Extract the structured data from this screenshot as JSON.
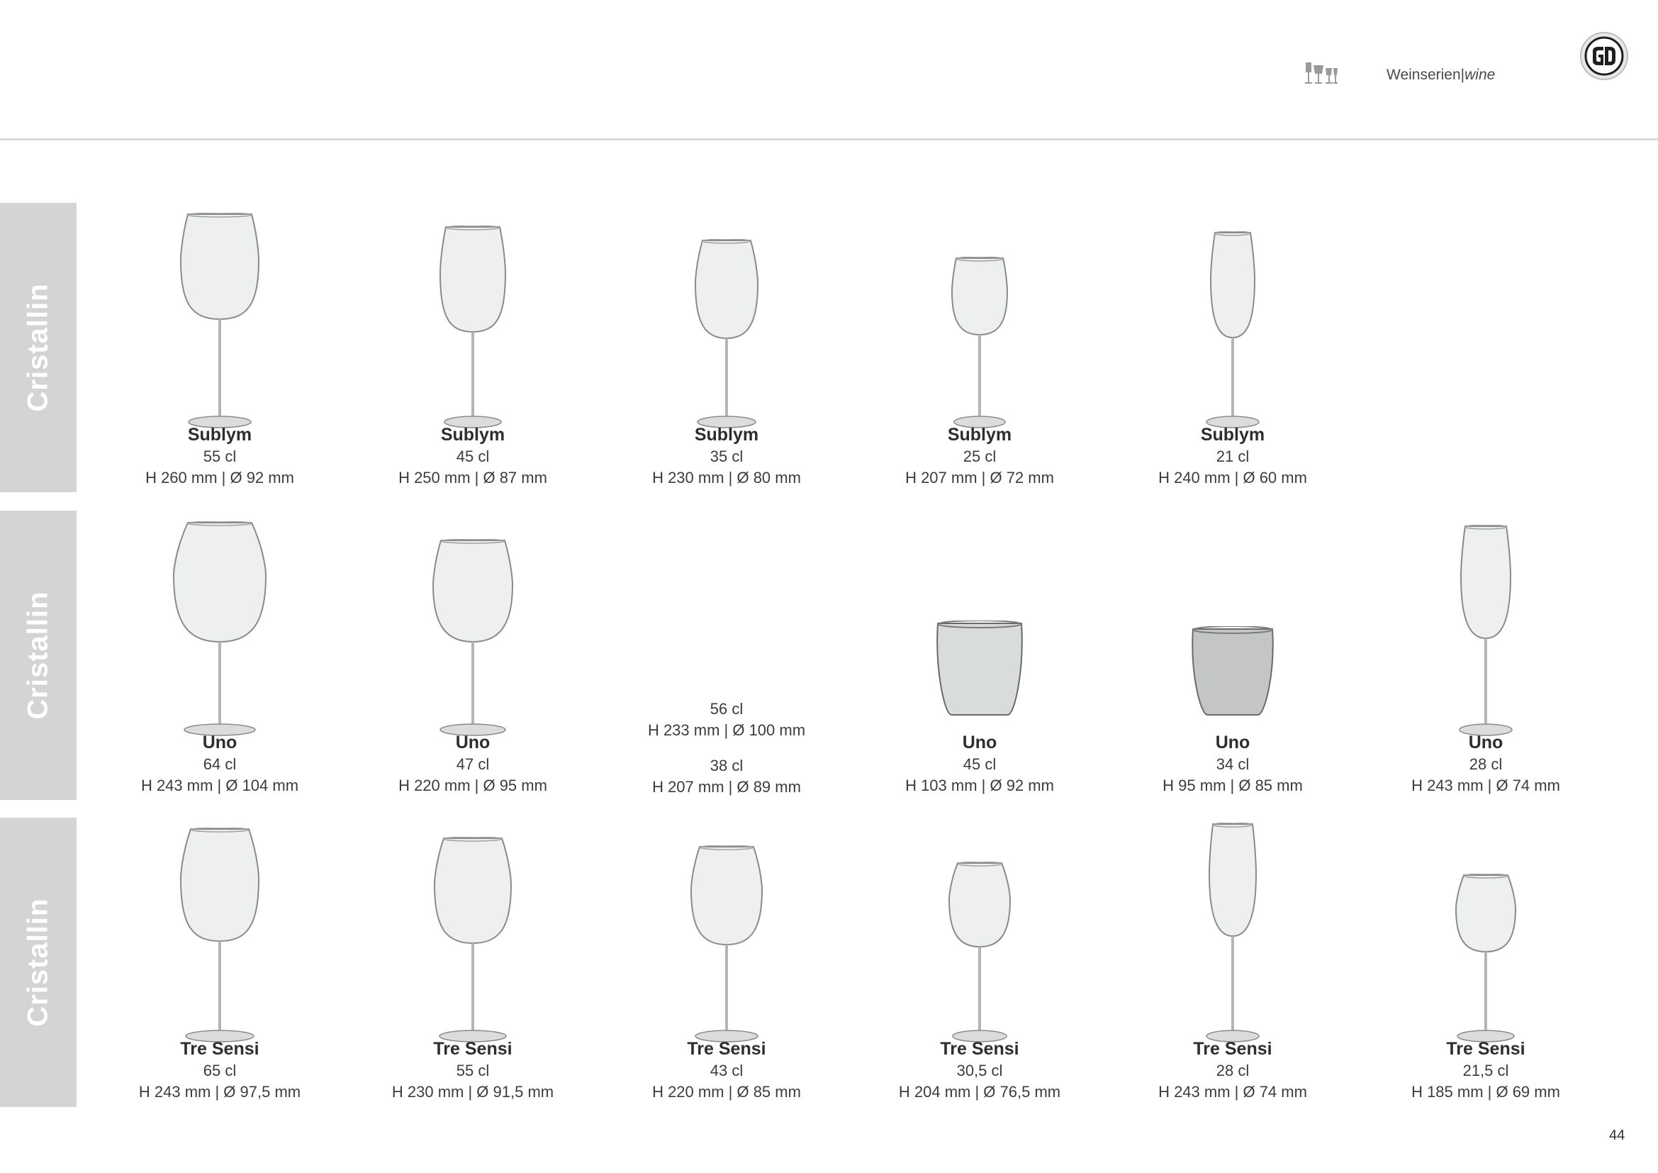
{
  "header": {
    "section_label": "Weinserien|",
    "section_label_italic": "wine",
    "logo_icon": "gd-logo-icon",
    "section_icon": "glasses-icon"
  },
  "tabs": [
    "Cristallin",
    "Cristallin",
    "Cristallin"
  ],
  "rows": [
    {
      "items": [
        {
          "name": "Sublym",
          "volume": "55 cl",
          "dims": "H 260 mm | Ø 92 mm"
        },
        {
          "name": "Sublym",
          "volume": "45 cl",
          "dims": "H 250 mm | Ø 87 mm"
        },
        {
          "name": "Sublym",
          "volume": "35 cl",
          "dims": "H 230 mm | Ø 80 mm"
        },
        {
          "name": "Sublym",
          "volume": "25 cl",
          "dims": "H 207 mm | Ø 72 mm"
        },
        {
          "name": "Sublym",
          "volume": "21 cl",
          "dims": "H 240 mm | Ø 60 mm"
        }
      ]
    },
    {
      "items": [
        {
          "name": "Uno",
          "volume": "64 cl",
          "dims": "H 243 mm | Ø 104 mm"
        },
        {
          "name": "Uno",
          "volume": "47 cl",
          "dims": "H 220 mm | Ø 95 mm"
        },
        {
          "volume": "56 cl",
          "dims": "H 233 mm | Ø 100 mm",
          "volume2": "38 cl",
          "dims2": "H 207 mm | Ø 89 mm"
        },
        {
          "name": "Uno",
          "volume": "45 cl",
          "dims": "H 103 mm | Ø 92 mm"
        },
        {
          "name": "Uno",
          "volume": "34 cl",
          "dims": "H 95 mm | Ø 85 mm"
        },
        {
          "name": "Uno",
          "volume": "28 cl",
          "dims": "H 243 mm | Ø 74 mm"
        }
      ]
    },
    {
      "items": [
        {
          "name": "Tre Sensi",
          "volume": "65 cl",
          "dims": "H 243 mm | Ø 97,5 mm"
        },
        {
          "name": "Tre Sensi",
          "volume": "55 cl",
          "dims": "H 230 mm | Ø 91,5 mm"
        },
        {
          "name": "Tre Sensi",
          "volume": "43 cl",
          "dims": "H 220 mm | Ø 85 mm"
        },
        {
          "name": "Tre Sensi",
          "volume": "30,5 cl",
          "dims": "H 204 mm | Ø 76,5 mm"
        },
        {
          "name": "Tre Sensi",
          "volume": "28 cl",
          "dims": "H 243 mm | Ø 74 mm"
        },
        {
          "name": "Tre Sensi",
          "volume": "21,5 cl",
          "dims": "H 185 mm | Ø 69 mm"
        }
      ]
    }
  ],
  "page_number": "44"
}
